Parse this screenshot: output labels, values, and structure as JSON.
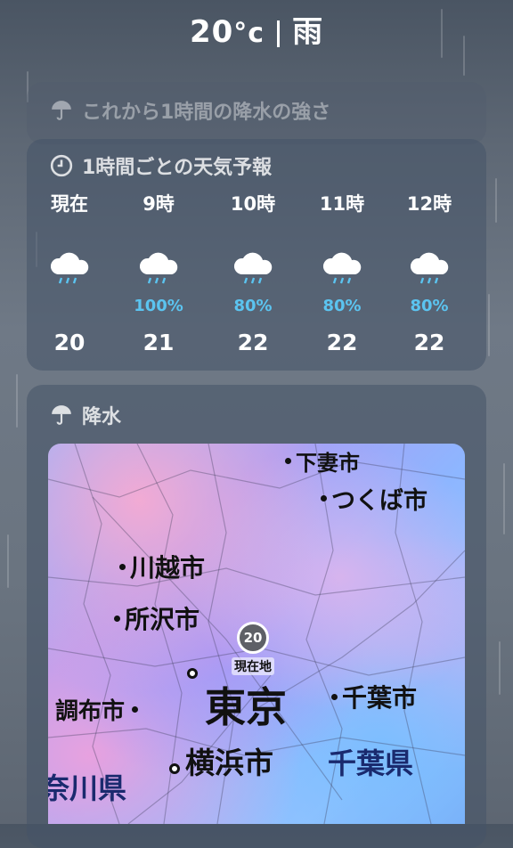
{
  "header": {
    "temperature": "20",
    "unit": "°c",
    "condition": "雨"
  },
  "precip_intensity": {
    "title": "これから1時間の降水の強さ",
    "icon": "umbrella-icon"
  },
  "hourly": {
    "title": "1時間ごとの天気予報",
    "icon": "clock-icon",
    "items": [
      {
        "label": "現在",
        "icon": "rain-cloud-icon",
        "precip": "",
        "temp": "20"
      },
      {
        "label": "9時",
        "icon": "rain-cloud-icon",
        "precip": "100%",
        "temp": "21"
      },
      {
        "label": "10時",
        "icon": "rain-cloud-icon",
        "precip": "80%",
        "temp": "22"
      },
      {
        "label": "11時",
        "icon": "rain-cloud-icon",
        "precip": "80%",
        "temp": "22"
      },
      {
        "label": "12時",
        "icon": "rain-cloud-icon",
        "precip": "80%",
        "temp": "22"
      }
    ]
  },
  "precip_map": {
    "title": "降水",
    "icon": "umbrella-icon",
    "pin_value": "20",
    "pin_label": "現在地",
    "cities": {
      "shimotsuma": "下妻市",
      "tsukuba": "つくば市",
      "kawagoe": "川越市",
      "tokorozawa": "所沢市",
      "chofu": "調布市",
      "tokyo": "東京",
      "chiba_city": "千葉市",
      "yokohama": "横浜市",
      "chiba_pref": "千葉県",
      "kanagawa": "奈川県"
    }
  },
  "colors": {
    "precip_text": "#5bc4f0",
    "card_bg": "#465468"
  }
}
